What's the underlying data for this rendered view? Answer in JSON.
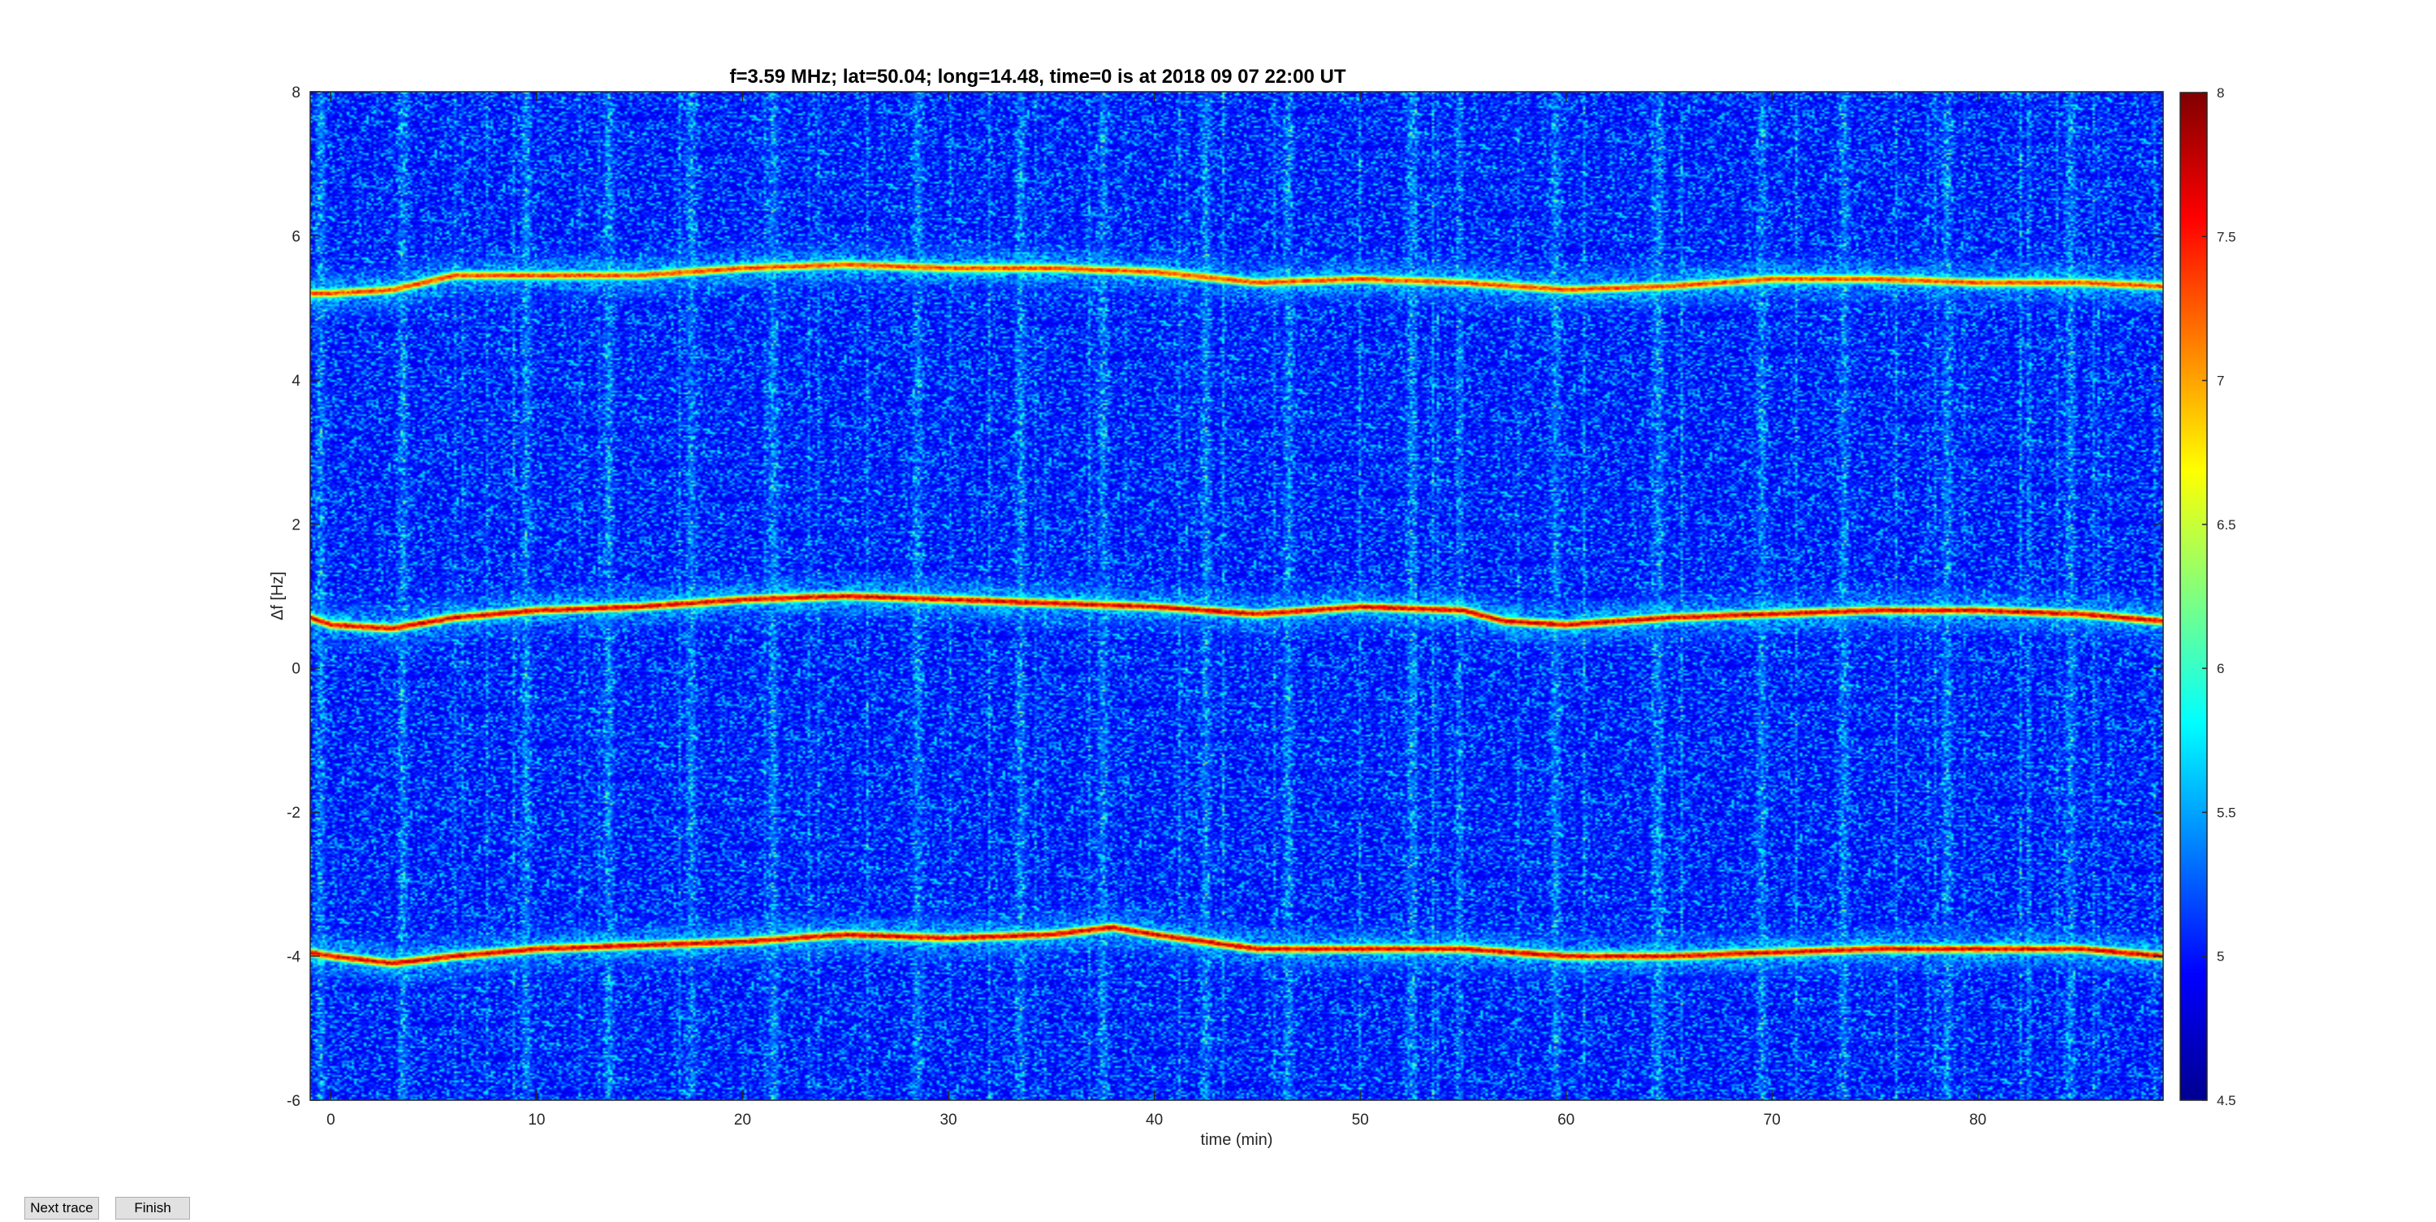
{
  "chart_data": {
    "type": "heatmap",
    "title": "f=3.59 MHz;  lat=50.04; long=14.48, time=0 is at 2018 09 07 22:00 UT",
    "xlabel": "time (min)",
    "ylabel": "Δf [Hz]",
    "xlim": [
      -1,
      89
    ],
    "ylim": [
      -6,
      8
    ],
    "xticks": [
      0,
      10,
      20,
      30,
      40,
      50,
      60,
      70,
      80
    ],
    "yticks": [
      -6,
      -4,
      -2,
      0,
      2,
      4,
      6,
      8
    ],
    "colorbar": {
      "min": 4.5,
      "max": 8,
      "ticks": [
        "4.5",
        "5",
        "5.5",
        "6",
        "6.5",
        "7",
        "7.5",
        "8"
      ],
      "colormap": "jet"
    },
    "background_level": 4.6,
    "traces": [
      {
        "peak_level": 7.6,
        "x": [
          -1,
          0,
          3,
          6,
          10,
          15,
          20,
          25,
          30,
          35,
          40,
          45,
          50,
          55,
          60,
          65,
          70,
          75,
          80,
          85,
          89
        ],
        "y": [
          5.2,
          5.2,
          5.25,
          5.45,
          5.45,
          5.45,
          5.55,
          5.6,
          5.55,
          5.55,
          5.5,
          5.35,
          5.4,
          5.35,
          5.25,
          5.3,
          5.4,
          5.4,
          5.35,
          5.35,
          5.3
        ]
      },
      {
        "peak_level": 8,
        "x": [
          -1,
          0,
          3,
          6,
          10,
          15,
          20,
          25,
          30,
          35,
          40,
          45,
          50,
          55,
          57,
          60,
          65,
          70,
          75,
          80,
          85,
          89
        ],
        "y": [
          0.7,
          0.6,
          0.55,
          0.7,
          0.8,
          0.85,
          0.95,
          1.0,
          0.95,
          0.9,
          0.85,
          0.75,
          0.85,
          0.8,
          0.65,
          0.6,
          0.7,
          0.75,
          0.8,
          0.8,
          0.75,
          0.65
        ]
      },
      {
        "peak_level": 8,
        "x": [
          -1,
          0,
          3,
          6,
          10,
          15,
          20,
          25,
          30,
          35,
          38,
          40,
          45,
          50,
          55,
          60,
          65,
          70,
          75,
          80,
          85,
          89
        ],
        "y": [
          -3.95,
          -4.0,
          -4.1,
          -4.0,
          -3.9,
          -3.85,
          -3.8,
          -3.7,
          -3.75,
          -3.7,
          -3.6,
          -3.7,
          -3.9,
          -3.9,
          -3.9,
          -4.0,
          -4.0,
          -3.95,
          -3.9,
          -3.9,
          -3.9,
          -4.0
        ]
      }
    ],
    "bright_columns_min": [
      -0.5,
      3.5,
      9.5,
      13.5,
      17.5,
      21.5,
      28.5,
      33.5,
      37.5,
      42.5,
      46.5,
      52.5,
      59.5,
      64.5,
      69.5,
      73.5,
      78.5,
      84.5
    ]
  },
  "buttons": {
    "next_label": "Next trace",
    "finish_label": "Finish"
  }
}
